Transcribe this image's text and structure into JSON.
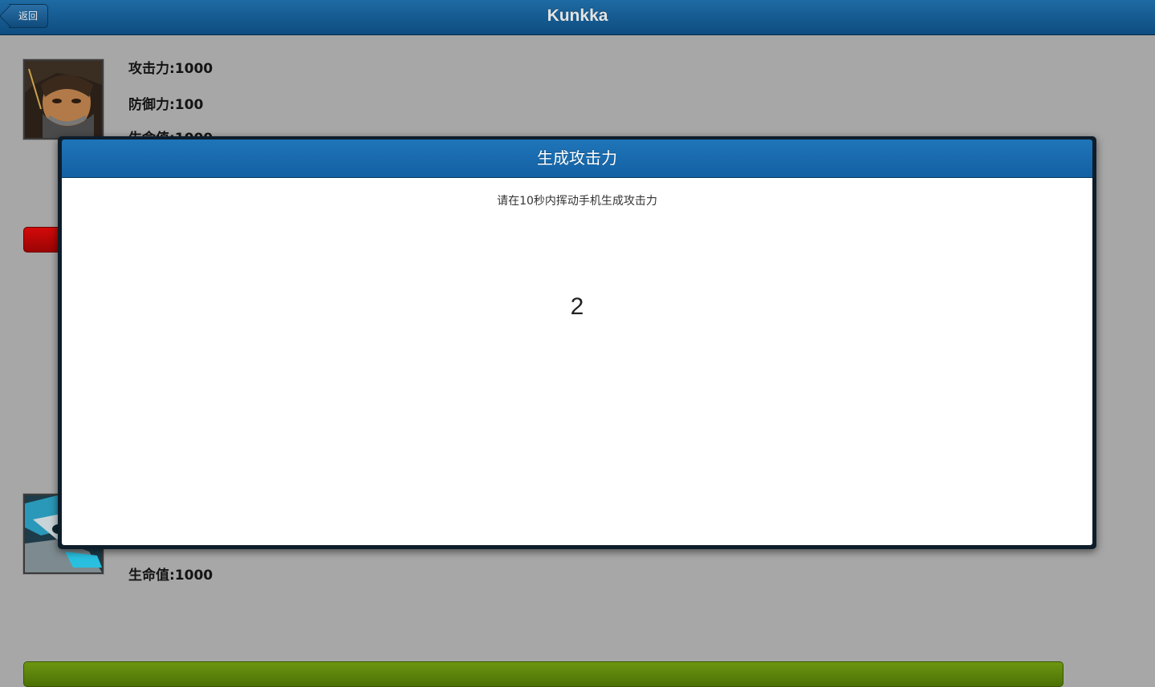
{
  "navbar": {
    "title": "Kunkka",
    "back_label": "返回"
  },
  "hero_1": {
    "avatar_icon": "kunkka-portrait-icon",
    "attack": "攻击力:1000",
    "defense": "防御力:100",
    "hp": "生命值:1000",
    "bar_color": "#c00808"
  },
  "hero_2": {
    "avatar_icon": "armored-hero-portrait-icon",
    "hp": "生命值:1000",
    "bar_color": "#5e8a0c"
  },
  "modal": {
    "title": "生成攻击力",
    "instruction": "请在10秒内挥动手机生成攻击力",
    "countdown": "2"
  },
  "colors": {
    "navbar": "#1a5f95",
    "modal_header": "#1a6db0",
    "background": "#a7a7a7"
  }
}
